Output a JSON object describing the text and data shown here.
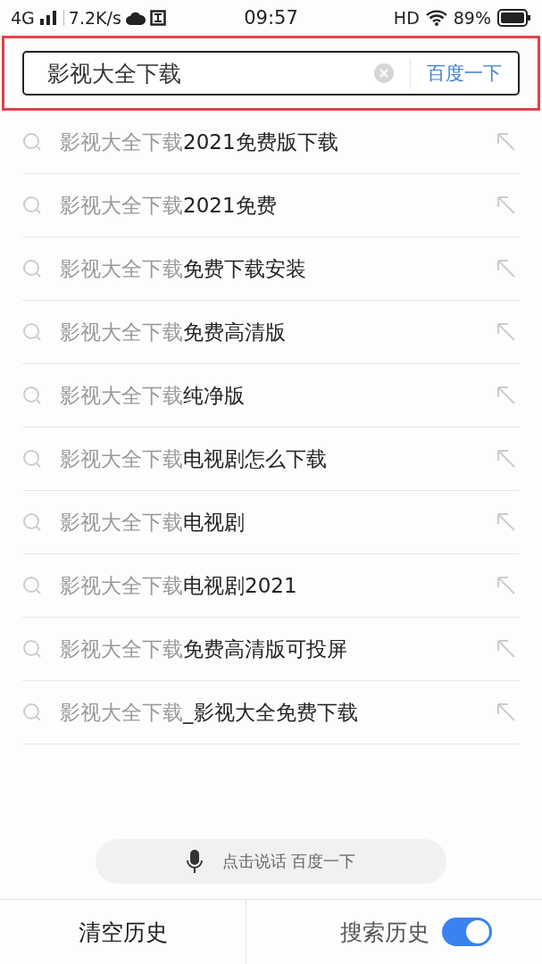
{
  "status_bar": {
    "network": "4G",
    "speed": "7.2K/s",
    "time": "09:57",
    "hd": "HD",
    "battery": "89%"
  },
  "search": {
    "value": "影视大全下载",
    "button": "百度一下"
  },
  "suggestions": [
    {
      "prefix": "影视大全下载",
      "suffix": "2021免费版下载"
    },
    {
      "prefix": "影视大全下载",
      "suffix": "2021免费"
    },
    {
      "prefix": "影视大全下载",
      "suffix": "免费下载安装"
    },
    {
      "prefix": "影视大全下载",
      "suffix": "免费高清版"
    },
    {
      "prefix": "影视大全下载",
      "suffix": "纯净版"
    },
    {
      "prefix": "影视大全下载",
      "suffix": "电视剧怎么下载"
    },
    {
      "prefix": "影视大全下载",
      "suffix": "电视剧"
    },
    {
      "prefix": "影视大全下载",
      "suffix": "电视剧2021"
    },
    {
      "prefix": "影视大全下载",
      "suffix": "免费高清版可投屏"
    },
    {
      "prefix": "影视大全下载",
      "suffix": "_影视大全免费下载"
    }
  ],
  "voice": {
    "label": "点击说话 百度一下"
  },
  "bottom_bar": {
    "clear": "清空历史",
    "history_label": "搜索历史",
    "history_on": true
  }
}
